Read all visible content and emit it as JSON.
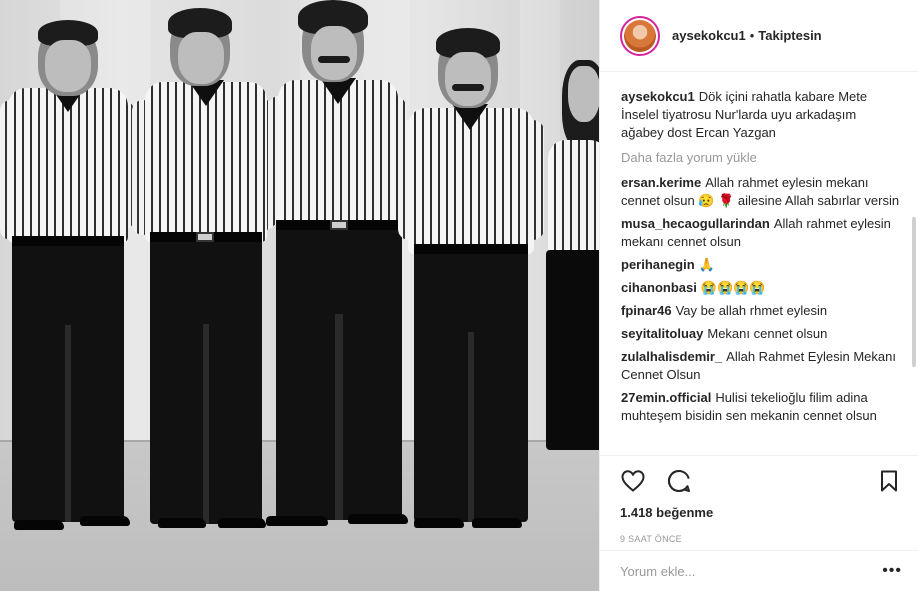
{
  "header": {
    "username": "aysekokcu1",
    "separator": "•",
    "follow_status": "Takiptesin"
  },
  "comments": [
    {
      "user": "aysekokcu1",
      "text": "Dök içini rahatla kabare Mete İnselel tiyatrosu Nur'larda uyu arkadaşım ağabey dost Ercan Yazgan"
    },
    {
      "user": "ersan.kerime",
      "text": "Allah rahmet eylesin mekanı cennet olsun 😥 🌹 ailesine Allah sabırlar versin"
    },
    {
      "user": "musa_hecaogullarindan",
      "text": "Allah rahmet eylesin mekanı cennet olsun"
    },
    {
      "user": "perihanegin",
      "text": "🙏"
    },
    {
      "user": "cihanonbasi",
      "text": "😭😭😭😭"
    },
    {
      "user": "fpinar46",
      "text": "Vay be allah rhmet eylesin"
    },
    {
      "user": "seyitalitoluay",
      "text": "Mekanı cennet olsun"
    },
    {
      "user": "zulalhalisdemir_",
      "text": "Allah Rahmet Eylesin Mekanı Cennet Olsun"
    },
    {
      "user": "27emin.official",
      "text": "Hulisi tekelioğlu filim adina muhteşem bisidin sen mekanin cennet olsun"
    }
  ],
  "load_more": "Daha fazla yorum yükle",
  "actions": {
    "icons": [
      "heart-icon",
      "comment-icon",
      "bookmark-icon"
    ]
  },
  "likes": "1.418 beğenme",
  "time": "9 SAAT ÖNCE",
  "add_comment": {
    "placeholder": "Yorum ekle...",
    "more": "•••"
  }
}
